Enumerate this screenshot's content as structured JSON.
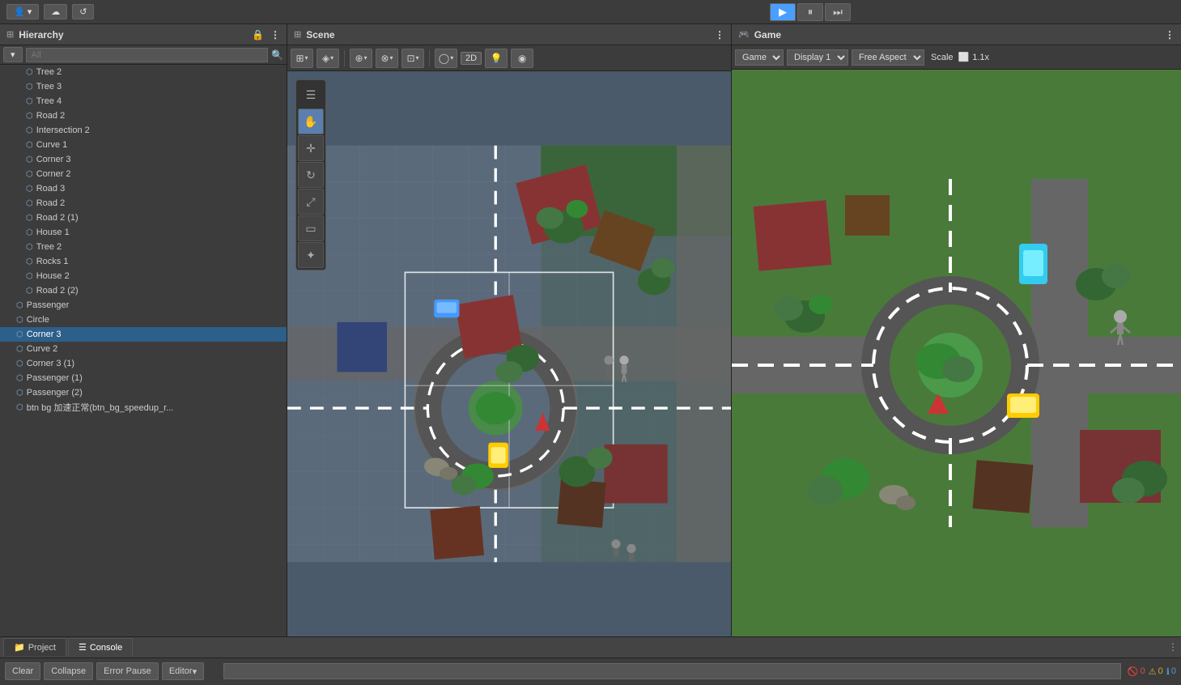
{
  "topbar": {
    "account_icon": "👤",
    "cloud_icon": "☁",
    "history_icon": "↺",
    "play_label": "▶",
    "pause_label": "⏸",
    "step_label": "⏭"
  },
  "hierarchy": {
    "title": "Hierarchy",
    "lock_icon": "🔒",
    "menu_icon": "⋮",
    "search_placeholder": "All",
    "dropdown_icon": "▾",
    "items": [
      {
        "label": "Tree 2",
        "indent": 32,
        "selected": false
      },
      {
        "label": "Tree 3",
        "indent": 32,
        "selected": false
      },
      {
        "label": "Tree 4",
        "indent": 32,
        "selected": false
      },
      {
        "label": "Road 2",
        "indent": 32,
        "selected": false
      },
      {
        "label": "Intersection 2",
        "indent": 32,
        "selected": false
      },
      {
        "label": "Curve 1",
        "indent": 32,
        "selected": false
      },
      {
        "label": "Corner 3",
        "indent": 32,
        "selected": false
      },
      {
        "label": "Corner 2",
        "indent": 32,
        "selected": false
      },
      {
        "label": "Road 3",
        "indent": 32,
        "selected": false
      },
      {
        "label": "Road 2",
        "indent": 32,
        "selected": false
      },
      {
        "label": "Road 2 (1)",
        "indent": 32,
        "selected": false
      },
      {
        "label": "House 1",
        "indent": 32,
        "selected": false
      },
      {
        "label": "Tree 2",
        "indent": 32,
        "selected": false
      },
      {
        "label": "Rocks 1",
        "indent": 32,
        "selected": false
      },
      {
        "label": "House 2",
        "indent": 32,
        "selected": false
      },
      {
        "label": "Road 2 (2)",
        "indent": 32,
        "selected": false
      },
      {
        "label": "Passenger",
        "indent": 20,
        "selected": false
      },
      {
        "label": "Circle",
        "indent": 20,
        "selected": false
      },
      {
        "label": "Corner 3",
        "indent": 20,
        "selected": true
      },
      {
        "label": "Curve 2",
        "indent": 20,
        "selected": false
      },
      {
        "label": "Corner 3 (1)",
        "indent": 20,
        "selected": false
      },
      {
        "label": "Passenger (1)",
        "indent": 20,
        "selected": false
      },
      {
        "label": "Passenger (2)",
        "indent": 20,
        "selected": false
      },
      {
        "label": "btn bg 加速正常(btn_bg_speedup_r...",
        "indent": 20,
        "selected": false
      }
    ]
  },
  "scene": {
    "title": "Scene",
    "menu_icon": "⋮",
    "tools": {
      "transform_icon": "⊞",
      "move_icon": "✛",
      "rotate_icon": "↻",
      "scale_icon": "⤢",
      "rect_icon": "▭",
      "custom_icon": "✦",
      "2d_label": "2D",
      "light_icon": "💡",
      "audio_icon": "◉"
    }
  },
  "game": {
    "title": "Game",
    "menu_icon": "⋮",
    "game_label": "Game",
    "display_label": "Display 1",
    "aspect_label": "Free Aspect",
    "scale_label": "Scale",
    "scale_value": "1.1x"
  },
  "bottom": {
    "project_label": "Project",
    "console_label": "Console",
    "clear_label": "Clear",
    "collapse_label": "Collapse",
    "error_pause_label": "Error Pause",
    "editor_label": "Editor",
    "editor_dropdown": "▾",
    "search_placeholder": "",
    "error_icon": "🚫",
    "error_count": "0",
    "warn_icon": "⚠",
    "warn_count": "0",
    "info_icon": "ℹ",
    "info_count": "0"
  }
}
